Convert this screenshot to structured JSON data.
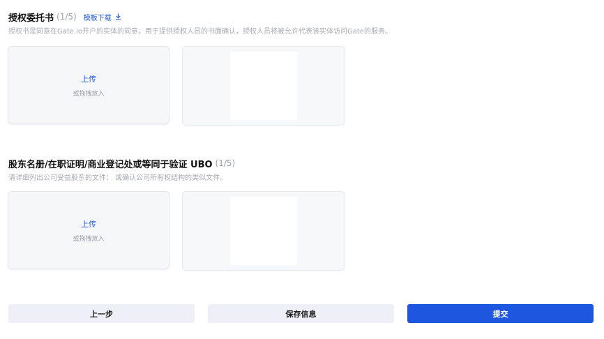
{
  "colors": {
    "accent": "#1e56e0",
    "muted_text": "#a7abb2",
    "secondary_button_bg": "#eff0f7"
  },
  "sections": [
    {
      "title": "授权委托书",
      "count": "(1/5)",
      "template_link": "模板下载",
      "template_icon": "download-icon",
      "description": "授权书是同意在Gate.io开户的实体的同意，用于提供授权人员的书面确认，授权人员将被允许代表该实体访问Gate的服务。",
      "upload": {
        "label": "上传",
        "hint": "或拖拽放入"
      }
    },
    {
      "title": "股东名册/在职证明/商业登记处或等同于验证 UBO",
      "count": "(1/5)",
      "description": "请详细列出公司受益股东的文件： 或确认公司所有权结构的类似文件。",
      "upload": {
        "label": "上传",
        "hint": "或拖拽放入"
      }
    }
  ],
  "footer": {
    "prev_label": "上一步",
    "save_label": "保存信息",
    "submit_label": "提交"
  }
}
